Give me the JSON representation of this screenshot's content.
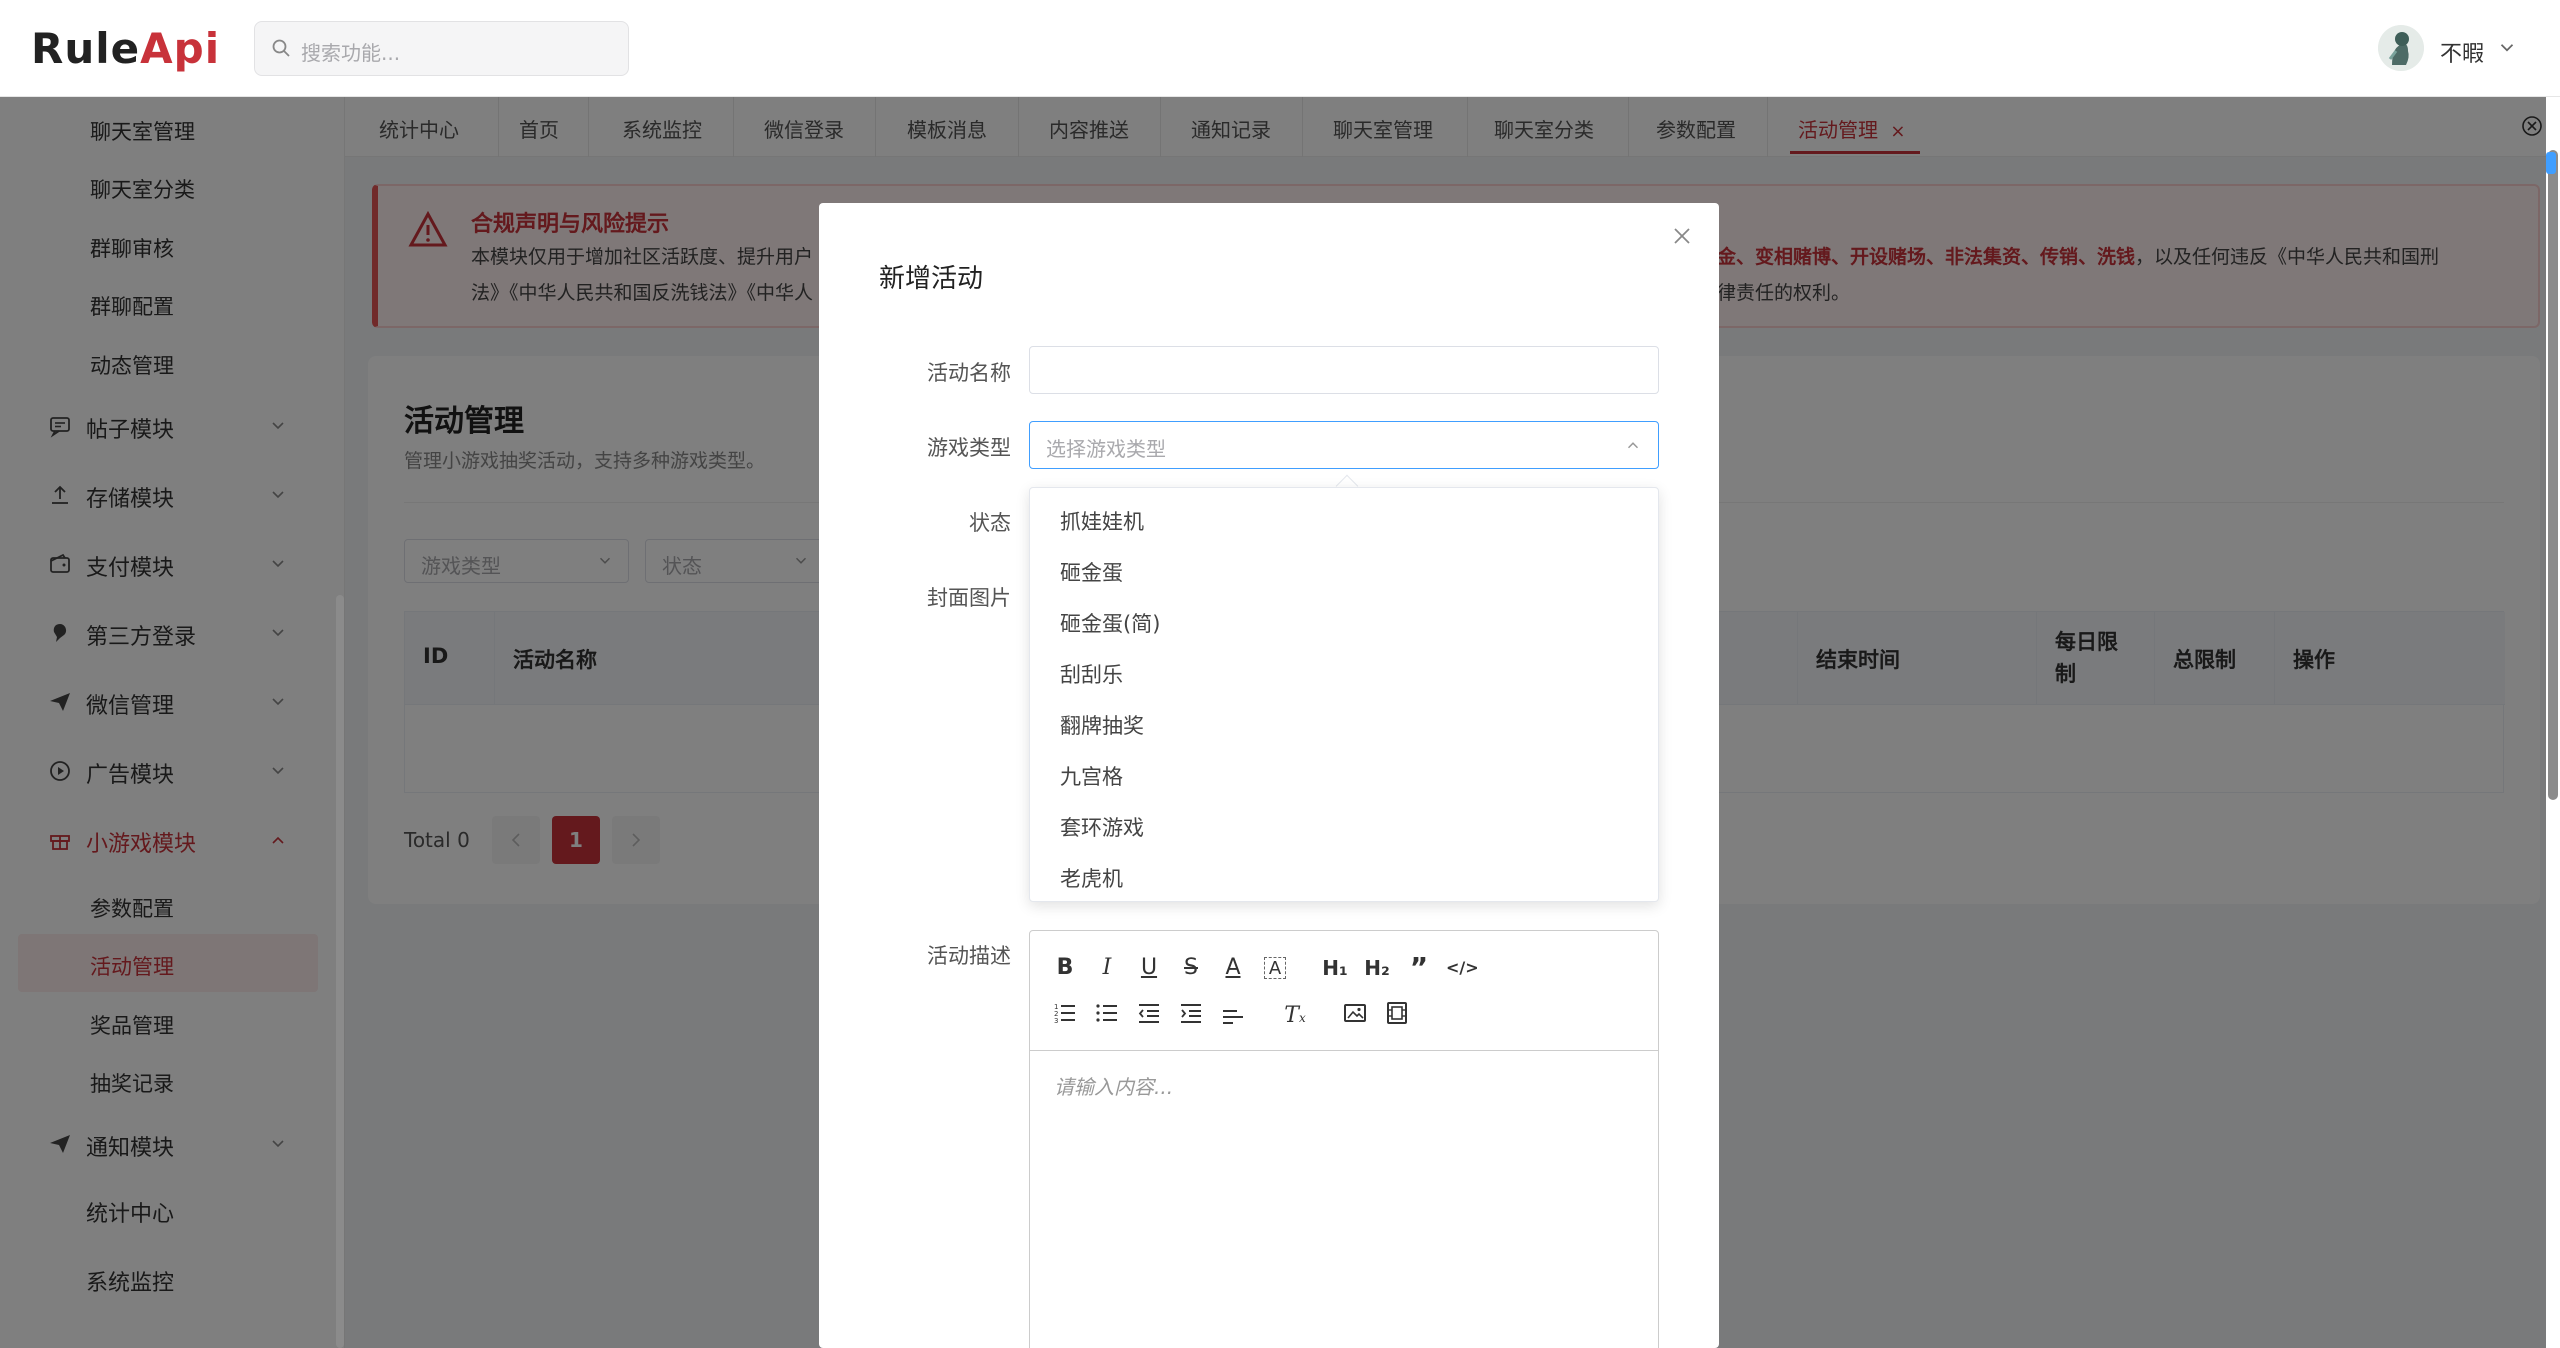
{
  "header": {
    "logo_part1": "Rule",
    "logo_part2": "Api",
    "search_placeholder": "搜索功能...",
    "user_name": "不暇"
  },
  "sidebar": {
    "chat_items": [
      "聊天室管理",
      "聊天室分类",
      "群聊审核",
      "群聊配置",
      "动态管理"
    ],
    "groups": [
      {
        "label": "帖子模块",
        "icon": "chat-icon"
      },
      {
        "label": "存储模块",
        "icon": "upload-icon"
      },
      {
        "label": "支付模块",
        "icon": "wallet-icon"
      },
      {
        "label": "第三方登录",
        "icon": "pin-icon"
      },
      {
        "label": "微信管理",
        "icon": "send-icon"
      },
      {
        "label": "广告模块",
        "icon": "play-icon"
      },
      {
        "label": "小游戏模块",
        "icon": "gift-icon"
      }
    ],
    "game_items": [
      "参数配置",
      "活动管理",
      "奖品管理",
      "抽奖记录"
    ],
    "notify_group": "通知模块",
    "stats": "统计中心",
    "monitor": "系统监控",
    "accent": "#c8323a"
  },
  "tabs": [
    "统计中心",
    "首页",
    "系统监控",
    "微信登录",
    "模板消息",
    "内容推送",
    "通知记录",
    "聊天室管理",
    "聊天室分类",
    "参数配置",
    "活动管理"
  ],
  "notice": {
    "title": "合规声明与风险提示",
    "line1_left": "本模块仅用于增加社区活跃度、提升用户",
    "line2_left": "法》《中华人民共和国反洗钱法》《中华人",
    "line1_right_red": "现金、变相赌博、开设赌场、非法集资、传销、洗钱",
    "line1_right_tail": "，以及任何违反《中华人民共和国刑",
    "line2_right": "法律责任的权利。"
  },
  "page": {
    "title": "活动管理",
    "subtitle": "管理小游戏抽奖活动，支持多种游戏类型。",
    "filter_game_type": "游戏类型",
    "filter_status": "状态",
    "columns_left": [
      "ID",
      "活动名称"
    ],
    "columns_right": [
      "结束时间",
      "每日限\n制",
      "总限制",
      "操作"
    ],
    "total": "Total 0",
    "current_page": "1"
  },
  "modal": {
    "title": "新增活动",
    "label_name": "活动名称",
    "label_game_type": "游戏类型",
    "game_type_placeholder": "选择游戏类型",
    "label_status": "状态",
    "label_cover": "封面图片",
    "label_desc": "活动描述",
    "options": [
      "抓娃娃机",
      "砸金蛋",
      "砸金蛋(简)",
      "刮刮乐",
      "翻牌抽奖",
      "九宫格",
      "套环游戏",
      "老虎机"
    ],
    "editor_placeholder": "请输入内容..."
  }
}
